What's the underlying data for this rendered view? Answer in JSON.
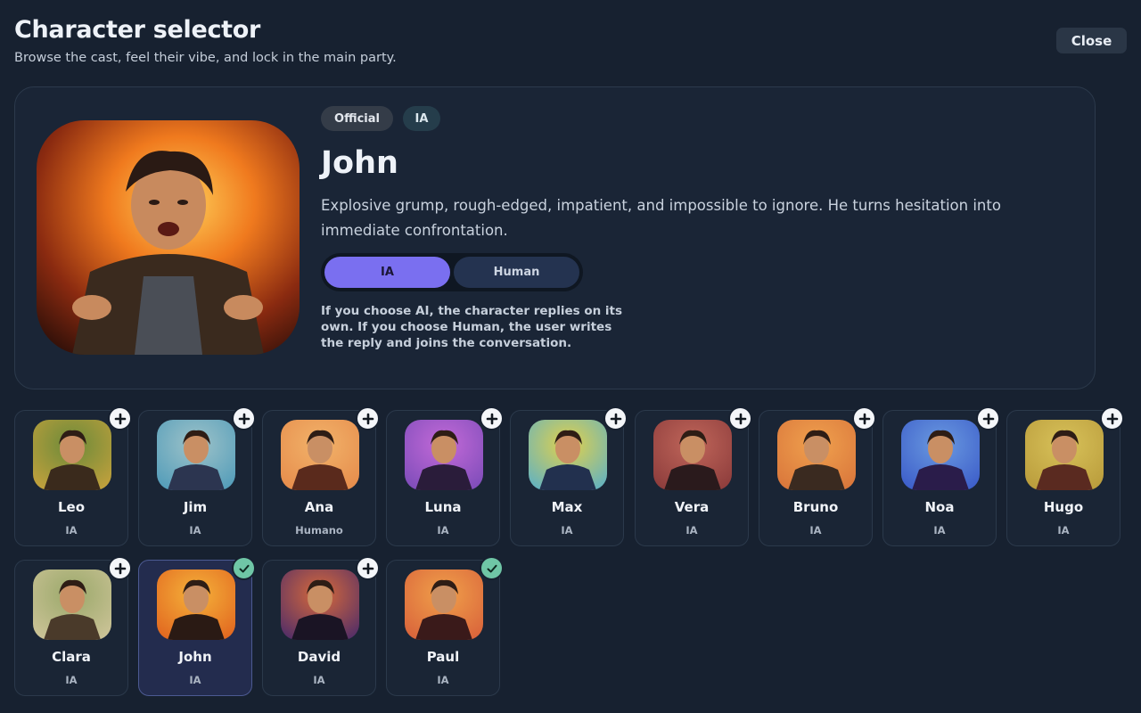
{
  "header": {
    "title": "Character selector",
    "subtitle": "Browse the cast, feel their vibe, and lock in the main party.",
    "close_label": "Close"
  },
  "featured": {
    "badges": [
      "Official",
      "IA"
    ],
    "name": "John",
    "description": "Explosive grump, rough-edged, impatient, and impossible to ignore. He turns hesitation into immediate confrontation.",
    "mode_toggle": {
      "options": [
        "IA",
        "Human"
      ],
      "selected": "IA"
    },
    "note": "If you choose AI, the character replies on its own. If you choose Human, the user writes the reply and joins the conversation."
  },
  "cast": [
    {
      "name": "Leo",
      "mode": "IA",
      "in_party": false,
      "selected": false,
      "palette": [
        "#c8a23c",
        "#6b8a3a",
        "#3a2a1c"
      ]
    },
    {
      "name": "Jim",
      "mode": "IA",
      "in_party": false,
      "selected": false,
      "palette": [
        "#4e9ab8",
        "#9fc3c9",
        "#2c3550"
      ]
    },
    {
      "name": "Ana",
      "mode": "Humano",
      "in_party": false,
      "selected": false,
      "palette": [
        "#e58a4a",
        "#f2b36a",
        "#5a2a1c"
      ]
    },
    {
      "name": "Luna",
      "mode": "IA",
      "in_party": false,
      "selected": false,
      "palette": [
        "#7a4bb8",
        "#c46ad8",
        "#2a1c3a"
      ]
    },
    {
      "name": "Max",
      "mode": "IA",
      "in_party": false,
      "selected": false,
      "palette": [
        "#5ab0c8",
        "#e3d14a",
        "#22304e"
      ]
    },
    {
      "name": "Vera",
      "mode": "IA",
      "in_party": false,
      "selected": false,
      "palette": [
        "#8a3a3a",
        "#c0665a",
        "#2a1a1c"
      ]
    },
    {
      "name": "Bruno",
      "mode": "IA",
      "in_party": false,
      "selected": false,
      "palette": [
        "#d8743a",
        "#f0a14e",
        "#3a2a20"
      ]
    },
    {
      "name": "Noa",
      "mode": "IA",
      "in_party": false,
      "selected": false,
      "palette": [
        "#3a5ac8",
        "#6a9ae0",
        "#2a1c4a"
      ]
    },
    {
      "name": "Hugo",
      "mode": "IA",
      "in_party": false,
      "selected": false,
      "palette": [
        "#b89a3a",
        "#d8c25a",
        "#5a2a20"
      ]
    },
    {
      "name": "Clara",
      "mode": "IA",
      "in_party": false,
      "selected": false,
      "palette": [
        "#cfc59a",
        "#9aa86a",
        "#4a3a2a"
      ]
    },
    {
      "name": "John",
      "mode": "IA",
      "in_party": true,
      "selected": true,
      "palette": [
        "#e0621e",
        "#f5b23a",
        "#2a1a14"
      ]
    },
    {
      "name": "David",
      "mode": "IA",
      "in_party": false,
      "selected": false,
      "palette": [
        "#4a2a6a",
        "#d86a3a",
        "#1a1424"
      ]
    },
    {
      "name": "Paul",
      "mode": "IA",
      "in_party": true,
      "selected": false,
      "palette": [
        "#d8603a",
        "#f0a04a",
        "#3a1a1a"
      ]
    }
  ]
}
